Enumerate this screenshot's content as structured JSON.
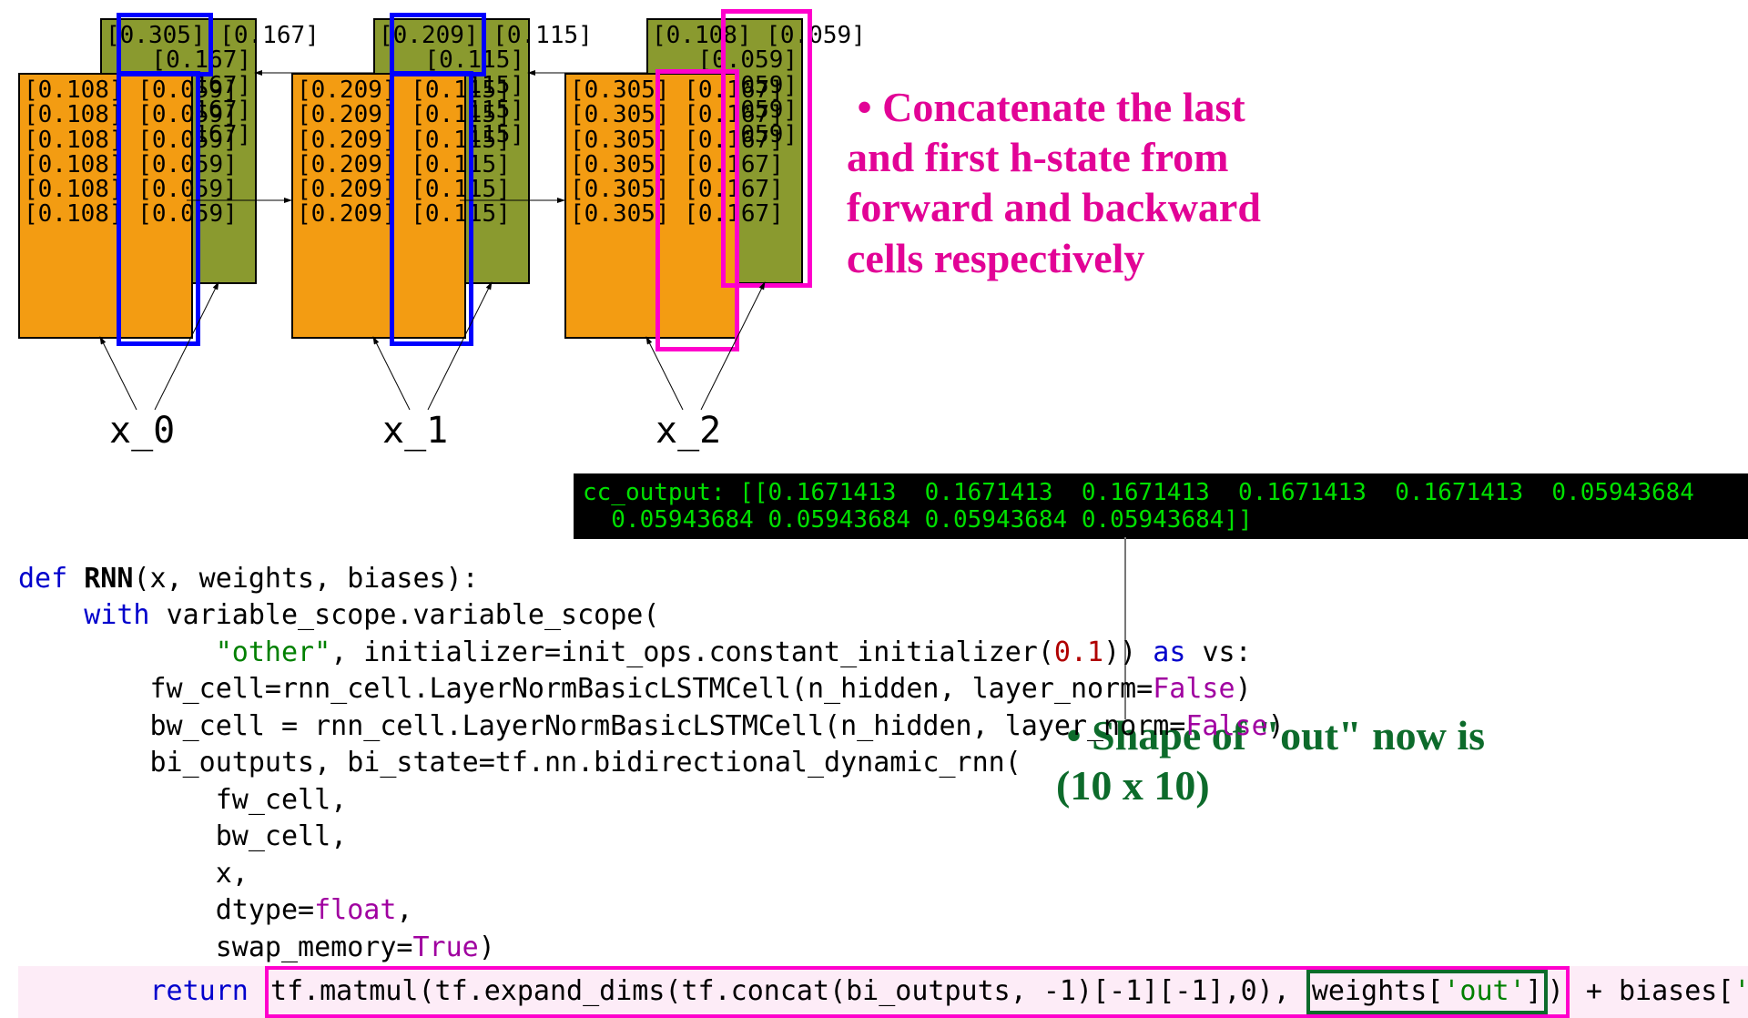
{
  "timesteps": [
    {
      "xlabel": "x_0",
      "back": [
        "[0.305] [0.167]",
        "[0.167]",
        "[0.167]",
        "[0.167]",
        "[0.167]"
      ],
      "front": [
        "[0.108] [0.059]",
        "[0.108] [0.059]",
        "[0.108] [0.059]",
        "[0.108] [0.059]",
        "[0.108] [0.059]",
        "[0.108] [0.059]"
      ]
    },
    {
      "xlabel": "x_1",
      "back": [
        "[0.209] [0.115]",
        "[0.115]",
        "[0.115]",
        "[0.115]",
        "[0.115]"
      ],
      "front": [
        "[0.209] [0.115]",
        "[0.209] [0.115]",
        "[0.209] [0.115]",
        "[0.209] [0.115]",
        "[0.209] [0.115]",
        "[0.209] [0.115]"
      ]
    },
    {
      "xlabel": "x_2",
      "back": [
        "[0.108] [0.059]",
        "[0.059]",
        "[0.059]",
        "[0.059]",
        "[0.059]"
      ],
      "front": [
        "[0.305] [0.167]",
        "[0.305] [0.167]",
        "[0.305] [0.167]",
        "[0.305] [0.167]",
        "[0.305] [0.167]",
        "[0.305] [0.167]"
      ]
    }
  ],
  "note_pink": " • Concatenate the last\nand first h-state from\nforward and backward\ncells respectively",
  "note_green": " • Shape of \"out\" now is\n(10 x 10)",
  "console": "cc_output: [[0.1671413  0.1671413  0.1671413  0.1671413  0.1671413  0.05943684\n  0.05943684 0.05943684 0.05943684 0.05943684]]",
  "code": {
    "l1a": "def ",
    "l1b": "RNN",
    "l1c": "(x, weights, biases):",
    "l2a": "    with ",
    "l2b": "variable_scope.variable_scope(",
    "l3a": "            ",
    "l3b": "\"other\"",
    "l3c": ", initializer=init_ops.constant_initializer(",
    "l3d": "0.1",
    "l3e": ")) ",
    "l3f": "as ",
    "l3g": "vs:",
    "l4a": "        fw_cell=rnn_cell.LayerNormBasicLSTMCell(n_hidden, layer_norm=",
    "l4b": "False",
    "l4c": ")",
    "l5a": "        bw_cell = rnn_cell.LayerNormBasicLSTMCell(n_hidden, layer_norm=",
    "l5b": "False",
    "l5c": ")",
    "l6": "        bi_outputs, bi_state=tf.nn.bidirectional_dynamic_rnn(",
    "l7": "            fw_cell,",
    "l8": "            bw_cell,",
    "l9": "            x,",
    "l10a": "            dtype=",
    "l10b": "float",
    "l10c": ",",
    "l11a": "            swap_memory=",
    "l11b": "True",
    "l11c": ")",
    "l12a": "        return ",
    "l12b": "tf.matmul(tf.expand_dims(tf.concat(bi_outputs, -1)[-1][-1],0), ",
    "l12c": "weights[",
    "l12d": "'out'",
    "l12e": "]",
    "l12f": ")",
    "l12g": " + biases[",
    "l12h": "'out'",
    "l12i": "]"
  }
}
